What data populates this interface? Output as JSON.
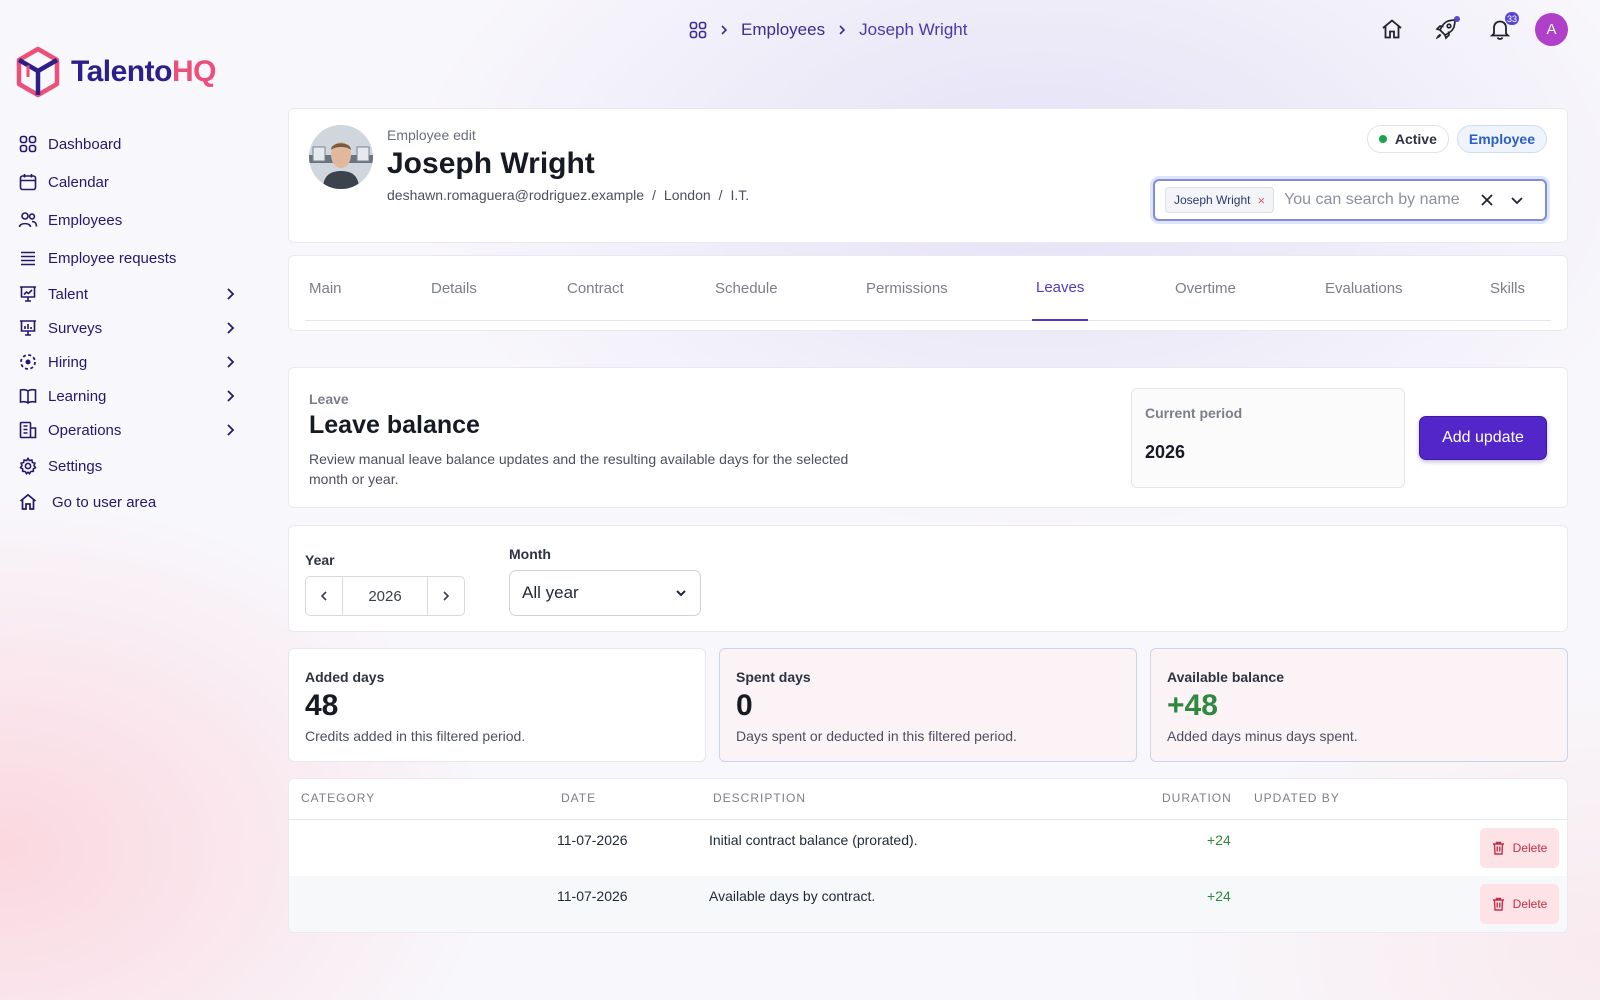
{
  "brand": {
    "name_part1": "Talento",
    "name_part2": "HQ",
    "color_primary": "#2d1f8a",
    "color_accent": "#ec4f7a"
  },
  "sidebar": {
    "items": [
      {
        "label": "Dashboard",
        "icon": "dashboard-grid-icon",
        "has_children": false
      },
      {
        "label": "Calendar",
        "icon": "calendar-icon",
        "has_children": false
      },
      {
        "label": "Employees",
        "icon": "users-icon",
        "has_children": false
      },
      {
        "label": "Employee requests",
        "icon": "list-icon",
        "has_children": false
      },
      {
        "label": "Talent",
        "icon": "presentation-chart-icon",
        "has_children": true
      },
      {
        "label": "Surveys",
        "icon": "survey-chart-icon",
        "has_children": true
      },
      {
        "label": "Hiring",
        "icon": "hiring-dashed-circle-icon",
        "has_children": true
      },
      {
        "label": "Learning",
        "icon": "book-icon",
        "has_children": true
      },
      {
        "label": "Operations",
        "icon": "building-icon",
        "has_children": true
      },
      {
        "label": "Settings",
        "icon": "gear-icon",
        "has_children": false
      },
      {
        "label": "Go to user area",
        "icon": "home-icon",
        "has_children": false
      }
    ]
  },
  "breadcrumb": {
    "items": [
      "Employees",
      "Joseph Wright"
    ],
    "home_icon": "dashboard-grid-icon"
  },
  "topbar": {
    "icons": [
      "home-icon",
      "rocket-icon",
      "bell-icon"
    ],
    "notification_count": "33",
    "avatar_initial": "A"
  },
  "employee": {
    "subtitle": "Employee edit",
    "name": "Joseph Wright",
    "email": "deshawn.romaguera@rodriguez.example",
    "separator": "/",
    "location": "London",
    "department": "I.T.",
    "status": "Active",
    "role": "Employee"
  },
  "employee_search": {
    "selected_chip": "Joseph Wright",
    "chip_remove": "×",
    "placeholder": "You can search by name"
  },
  "tabs": [
    "Main",
    "Details",
    "Contract",
    "Schedule",
    "Permissions",
    "Leaves",
    "Overtime",
    "Evaluations",
    "Skills"
  ],
  "active_tab": "Leaves",
  "leave_balance": {
    "kicker": "Leave",
    "title": "Leave balance",
    "description": "Review manual leave balance updates and the resulting available days for the selected month or year.",
    "current_period_label": "Current period",
    "current_period_value": "2026",
    "add_button": "Add update"
  },
  "filters": {
    "year_label": "Year",
    "year_value": "2026",
    "month_label": "Month",
    "month_value": "All year"
  },
  "stats": [
    {
      "label": "Added days",
      "value": "48",
      "description": "Credits added in this filtered period."
    },
    {
      "label": "Spent days",
      "value": "0",
      "description": "Days spent or deducted in this filtered period."
    },
    {
      "label": "Available balance",
      "value": "+48",
      "description": "Added days minus days spent."
    }
  ],
  "table": {
    "columns": [
      "CATEGORY",
      "DATE",
      "DESCRIPTION",
      "DURATION",
      "UPDATED BY"
    ],
    "rows": [
      {
        "category": "",
        "date": "11-07-2026",
        "description": "Initial contract balance (prorated).",
        "duration": "+24",
        "updated_by": "",
        "action": "Delete"
      },
      {
        "category": "",
        "date": "11-07-2026",
        "description": "Available days by contract.",
        "duration": "+24",
        "updated_by": "",
        "action": "Delete"
      }
    ]
  },
  "colors": {
    "active_tab": "#4c3bc8",
    "add_button": "#5226c9",
    "positive": "#2e8a3e",
    "delete": "#c62e46",
    "status_active_dot": "#1aa34a"
  }
}
